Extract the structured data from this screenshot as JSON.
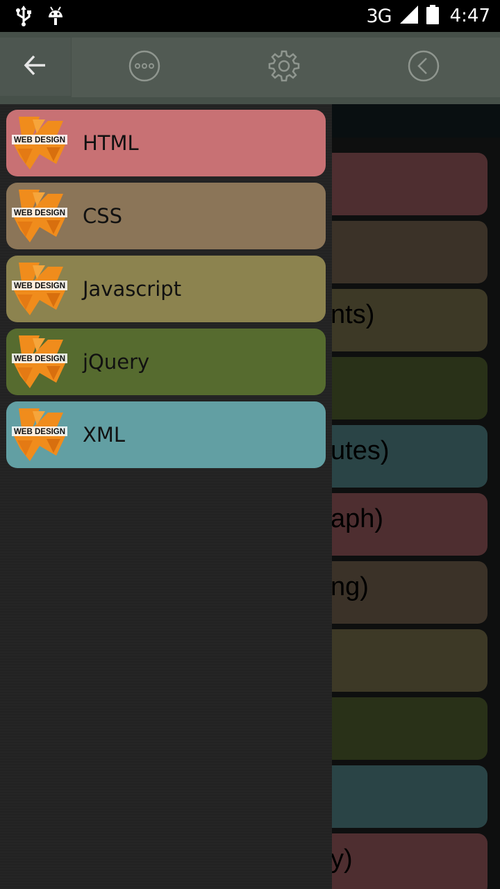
{
  "status_bar": {
    "left_icons": [
      "usb-icon",
      "android-debug-icon"
    ],
    "network": "3G",
    "right_icons": [
      "signal-icon",
      "battery-icon"
    ],
    "time": "4:47"
  },
  "toolbar": {
    "icons": [
      "back-arrow-icon",
      "more-options-icon",
      "settings-gear-icon",
      "circle-back-icon"
    ]
  },
  "drawer": {
    "logo_text": "WEB DESIGN",
    "items": [
      {
        "label": "HTML",
        "color": "#c87174"
      },
      {
        "label": "CSS",
        "color": "#8b7558"
      },
      {
        "label": "Javascript",
        "color": "#8c834f"
      },
      {
        "label": "jQuery",
        "color": "#566b2f"
      },
      {
        "label": "XML",
        "color": "#629fa3"
      }
    ]
  },
  "background_list": {
    "items": [
      {
        "text": "",
        "color": "#4e2e30"
      },
      {
        "text": "",
        "color": "#3b3228"
      },
      {
        "text": "nts)",
        "color": "#3d3926"
      },
      {
        "text": "",
        "color": "#293118"
      },
      {
        "text": "utes)",
        "color": "#2a4446"
      },
      {
        "text": "aph)",
        "color": "#4e2e30"
      },
      {
        "text": "ng)",
        "color": "#3b3228"
      },
      {
        "text": "",
        "color": "#3d3926"
      },
      {
        "text": "",
        "color": "#293118"
      },
      {
        "text": "",
        "color": "#2a4446"
      },
      {
        "text": "y)",
        "color": "#4e2e30"
      }
    ]
  }
}
